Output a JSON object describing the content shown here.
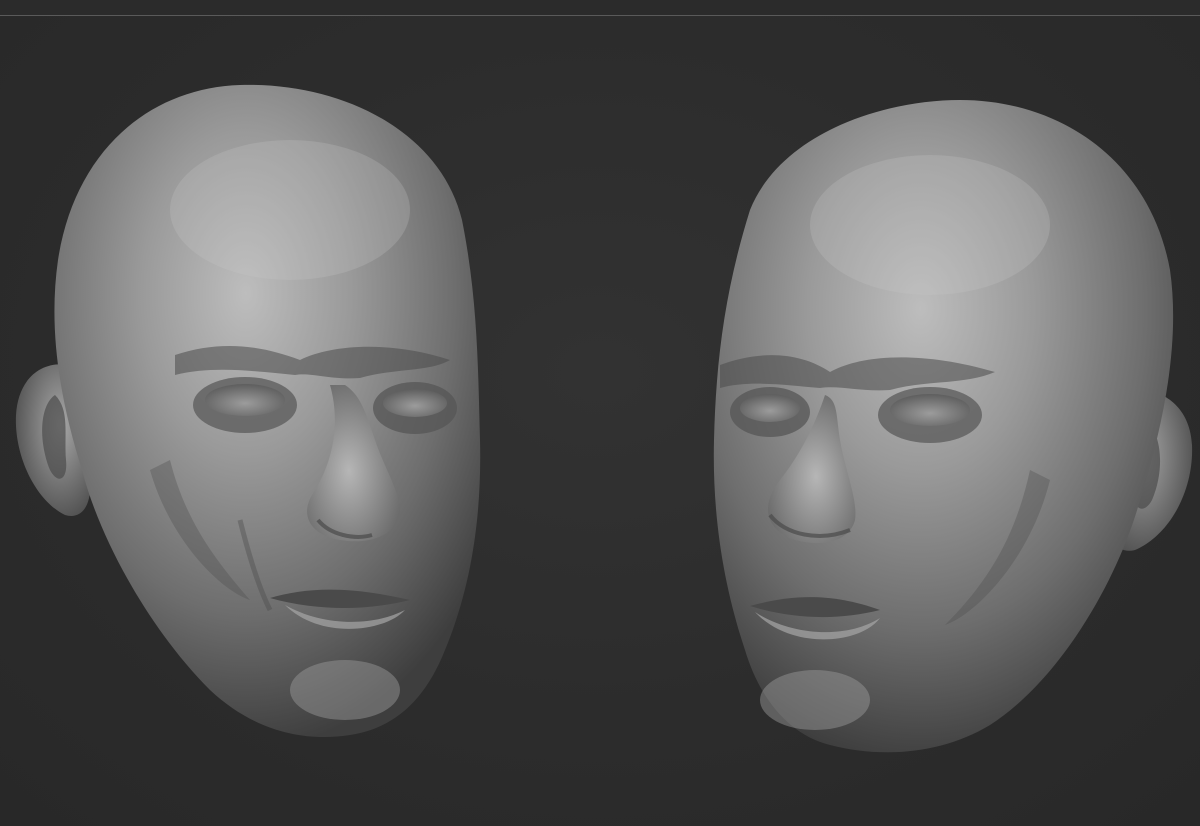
{
  "viewport": {
    "background": "#2b2b2b",
    "rule_color": "#5a5a5a"
  },
  "models": [
    {
      "id": "left",
      "view": "three-quarter-left"
    },
    {
      "id": "right",
      "view": "three-quarter-right"
    }
  ],
  "material": {
    "base": "#8e8e8e",
    "highlight": "#c4c4c4",
    "shadow": "#3a3a3a"
  }
}
